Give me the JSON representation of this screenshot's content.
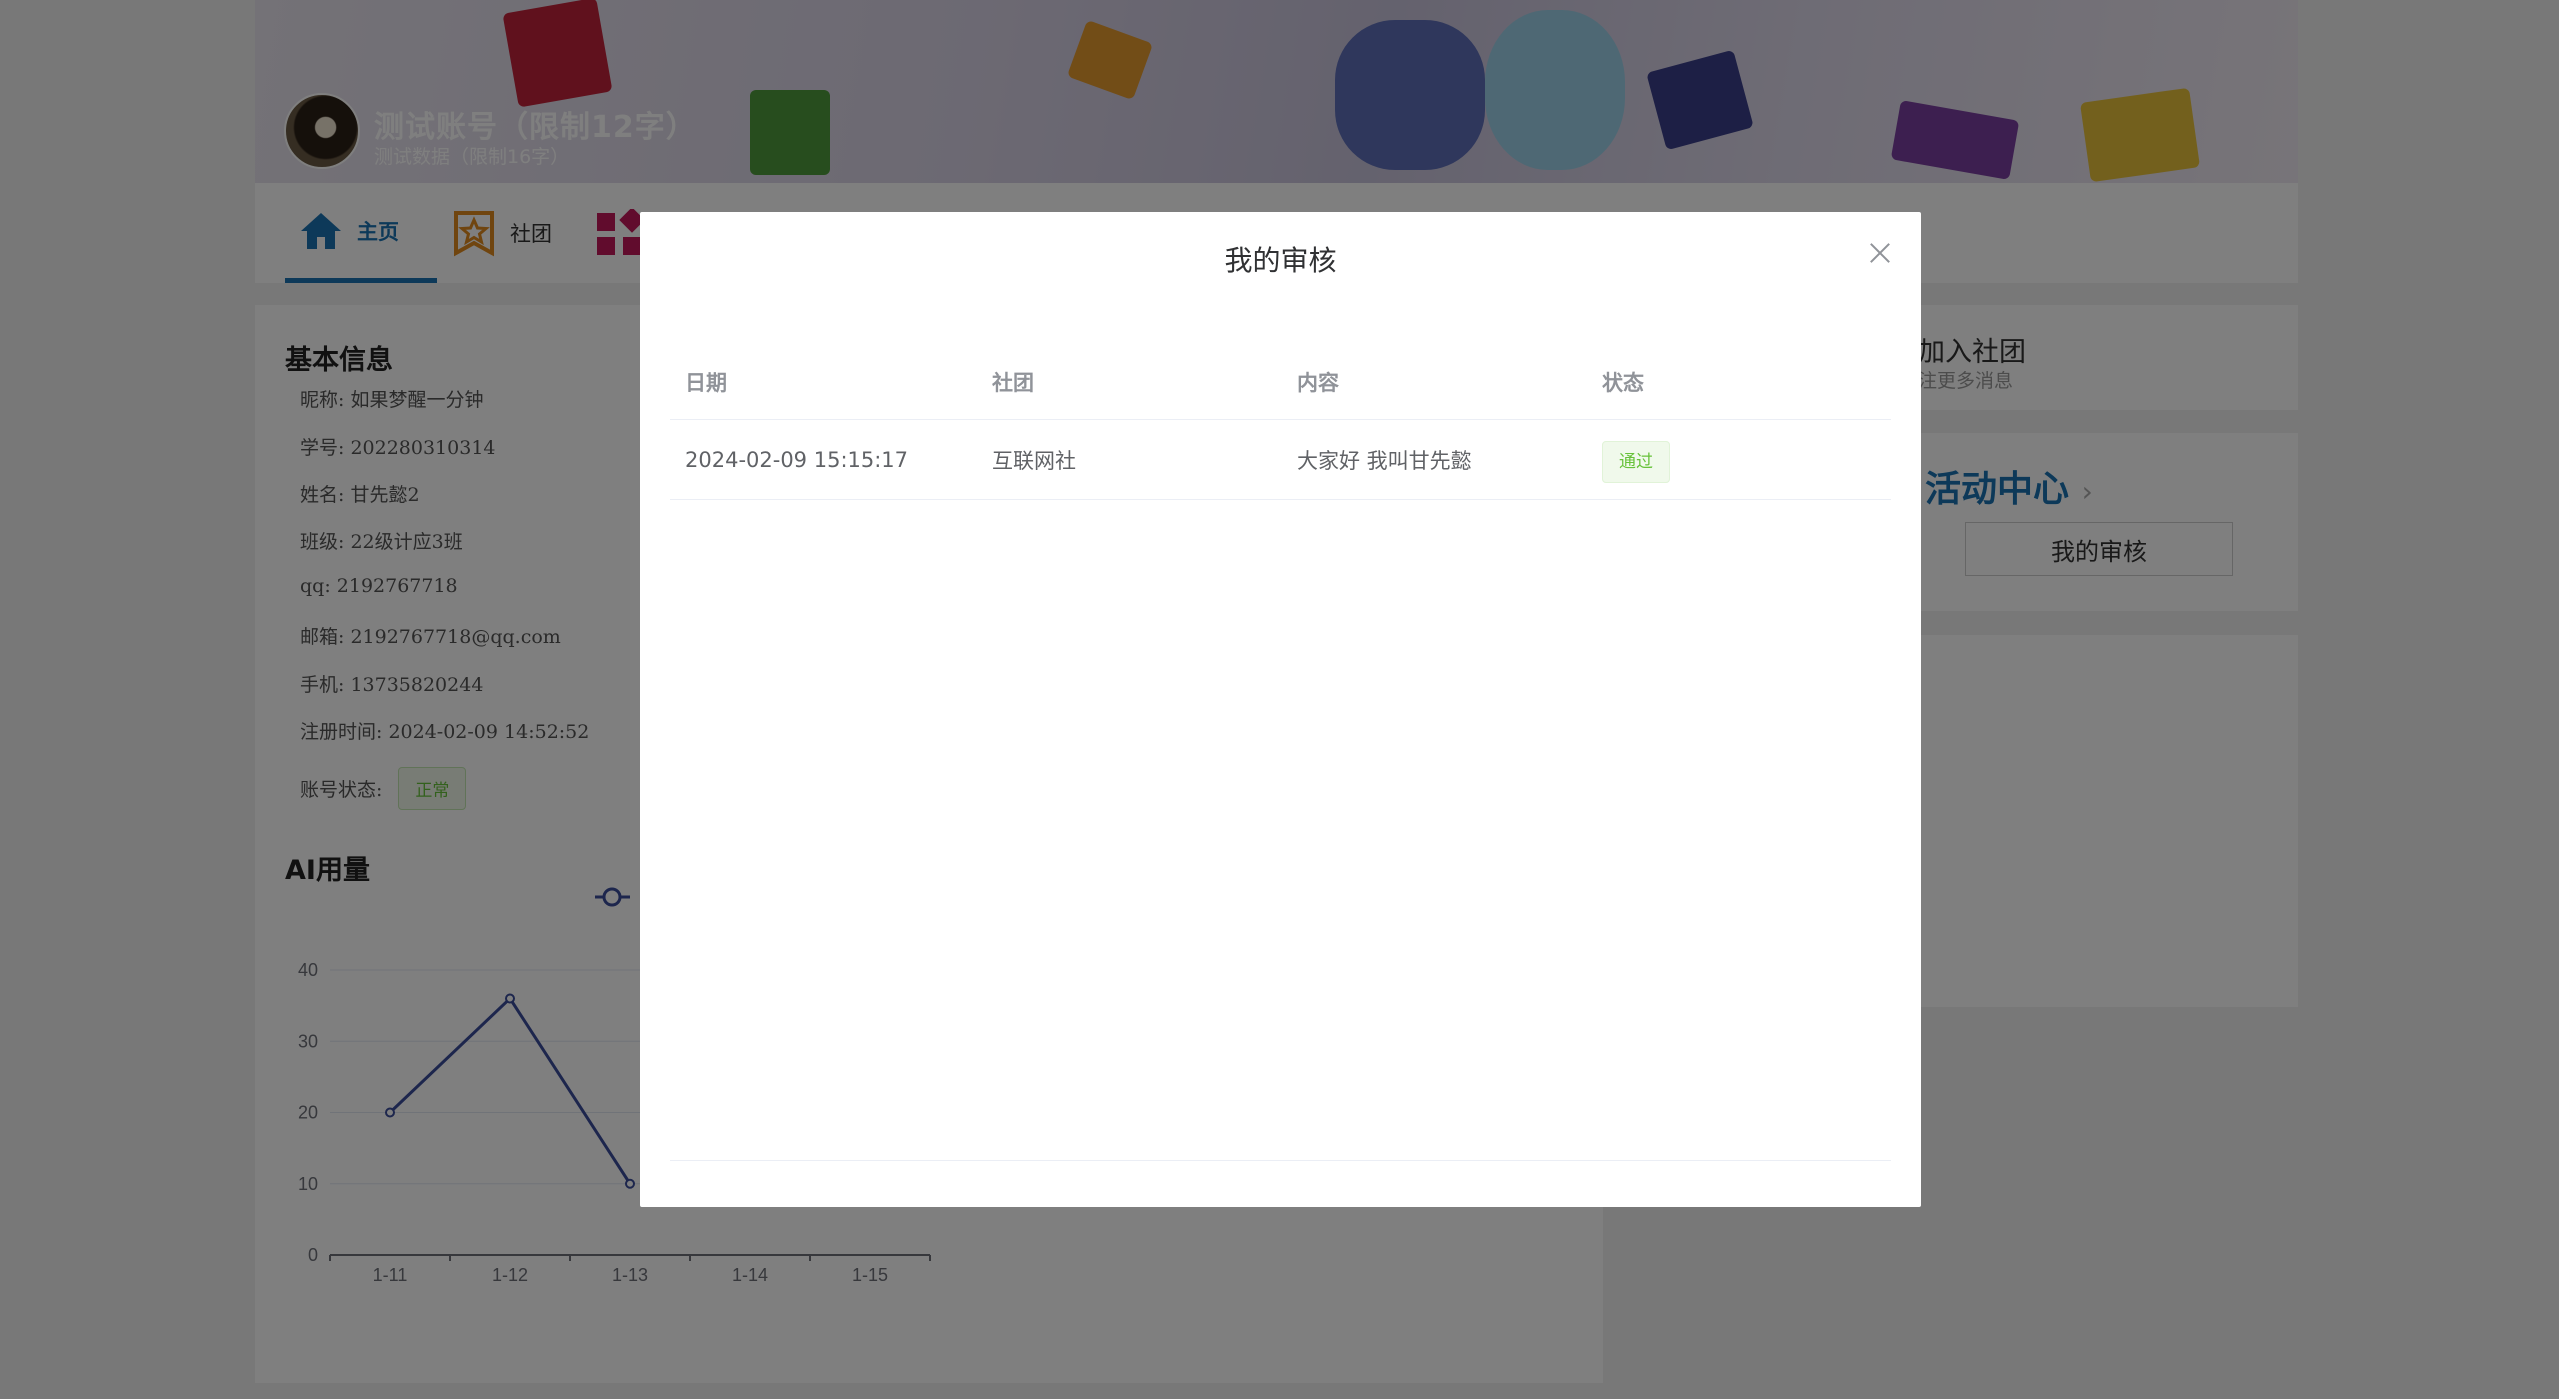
{
  "banner": {
    "account_name": "测试账号（限制12字）",
    "account_sub": "测试数据（限制16字）"
  },
  "tabs": [
    {
      "label": "主页",
      "icon": "home-icon"
    },
    {
      "label": "社团",
      "icon": "star-badge-icon"
    },
    {
      "label": "",
      "icon": "apps-grid-icon"
    }
  ],
  "basic_info": {
    "title": "基本信息",
    "rows": [
      "昵称: 如果梦醒一分钟",
      "学号: 202280310314",
      "姓名: 甘先懿2",
      "班级: 22级计应3班",
      "qq: 2192767718",
      "邮箱: 2192767718@qq.com",
      "手机: 13735820244",
      "注册时间: 2024-02-09 14:52:52"
    ],
    "status_label": "账号状态:",
    "status_value": "正常"
  },
  "ai_usage": {
    "title": "AI用量"
  },
  "chart_data": {
    "type": "line",
    "title": "AI用量",
    "xlabel": "",
    "ylabel": "",
    "categories": [
      "1-11",
      "1-12",
      "1-13",
      "1-14",
      "1-15"
    ],
    "series": [
      {
        "values": [
          20,
          36,
          10,
          null,
          null
        ]
      }
    ],
    "yticks": [
      0,
      10,
      20,
      30,
      40
    ],
    "ylim": [
      0,
      40
    ],
    "grid": true,
    "color": "#3b4c9a"
  },
  "right": {
    "join_title": "加入社团",
    "join_sub": "注更多消息",
    "activity_title": "活动中心",
    "audit_button": "我的审核"
  },
  "dialog": {
    "title": "我的审核",
    "columns": [
      "日期",
      "社团",
      "内容",
      "状态"
    ],
    "rows": [
      {
        "date": "2024-02-09 15:15:17",
        "club": "互联网社",
        "content": "大家好 我叫甘先懿",
        "status": "通过"
      }
    ]
  }
}
